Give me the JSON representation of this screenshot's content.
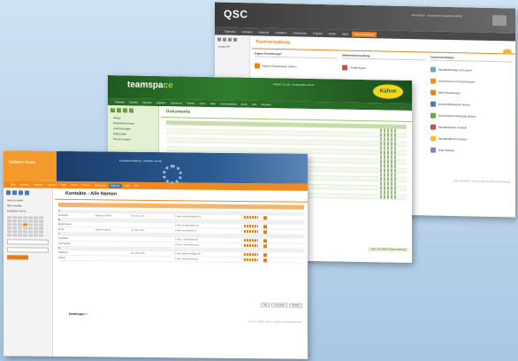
{
  "win_qsc": {
    "logo": "QSC",
    "header_info": "TeamSpace · Kooperative Zusammenarbeit",
    "nav": [
      "Startseite",
      "Kontakte",
      "Kalender",
      "Aufgaben",
      "Dokumente",
      "Projekte",
      "Zeiten",
      "Mails",
      "Teamverwaltung"
    ],
    "nav_active": 8,
    "left_items": [
      "Lizenz 05"
    ],
    "title": "Teamverwaltung",
    "columns": [
      {
        "heading": "Eigene Einstellungen",
        "items": [
          "Eigene Einstellungen ändern"
        ]
      },
      {
        "heading": "Mitarbeiterverwaltung",
        "items": [
          "Profile/Typen"
        ]
      },
      {
        "heading": "Teameinstellungen",
        "items": [
          "Standardeinträge auf Layout",
          "Lizenzierung und Einstellungen",
          "SMS Einstellungen",
          "Benachrichtigungen ändern",
          "Sicherheitseinstellungen ändern",
          "Standardrechte Handeln",
          "Standardarbeit anzeigen",
          "Team löschen"
        ]
      }
    ],
    "footer": "Team 1S LINEKE Löhn Co. Status Lizenzmodell Anleitung"
  },
  "win_green": {
    "brand_a": "teamspa",
    "brand_b": "ce",
    "header_mid": "FAMILY CLUB · Kooperative Arbeit",
    "kuehne": "Kühne",
    "nav": [
      "Startseite",
      "Kontakte",
      "Kalender",
      "Aufgaben",
      "Dokumente",
      "Projekte",
      "Zeiten",
      "Mails",
      "Teamverwaltung",
      "Suche",
      "Hilfe",
      "Abmelden"
    ],
    "left_items": [
      "Ablage",
      "Mitarbeiterhinweise",
      "Zeiterfassungen",
      "Mitteilungen",
      "Wiedervorlagen"
    ],
    "title": "Dokumente",
    "bottom": "Team 1S LINEKE Status Anleitung"
  },
  "win_kontakte": {
    "logo": "Software Group",
    "header_mid": "Kontaktverwaltung · Software Group",
    "nav": [
      "Start",
      "Kontakte",
      "Aufgaben",
      "Kalender",
      "Mails",
      "Zeiten",
      "Projekte",
      "Dokumente",
      "Kalender",
      "Links",
      "Hilfe"
    ],
    "nav_active": 8,
    "left_items": [
      "Neuer Kontakt",
      "Alle Kontakte",
      "Erweiterte Suche"
    ],
    "title": "Kontakte - Alle Namen",
    "rows": [
      {
        "name": "A",
        "letter": true
      },
      {
        "name": "Schlachter",
        "mid": "Hannover GmbH",
        "tel": "Tel. 0511-1234",
        "mail": "E-Mail: schlachter@gmx.de"
      },
      {
        "name": "B",
        "letter": true
      },
      {
        "name": "Bürgermeister",
        "mid": "",
        "tel": "",
        "mail": "E-Mail: buerger@gmx.de"
      },
      {
        "name": "Fricke",
        "mid": "Stadtverwaltung",
        "tel": "Tel. 0511-4321",
        "mail": "E-Mail: fricke@web.de"
      },
      {
        "name": "C",
        "letter": true
      },
      {
        "name": "Carl Meier",
        "mid": "",
        "tel": "",
        "mail": "E-Mail: c.meier@web.de"
      },
      {
        "name": "Carla Schulz",
        "mid": "",
        "tel": "",
        "mail": "E-Mail: c.schulz@web.de"
      },
      {
        "name": "D",
        "letter": true
      },
      {
        "name": "Dahlmann",
        "mid": "",
        "tel": "Tel. 0511-5555",
        "mail": "E-Mail: dahlmann@gmx.de"
      },
      {
        "name": "Dietrich",
        "mid": "",
        "tel": "",
        "mail": "E-Mail: dietrich@web.de"
      }
    ],
    "buttons": [
      "Neu",
      "Auswählen",
      "Drucken"
    ],
    "bottom_logo_a": "teamspa",
    "bottom_logo_b": "ce",
    "copy": "Team 1S LINEKE Löhn Co. Status Lizenzmodell Anleitung"
  }
}
